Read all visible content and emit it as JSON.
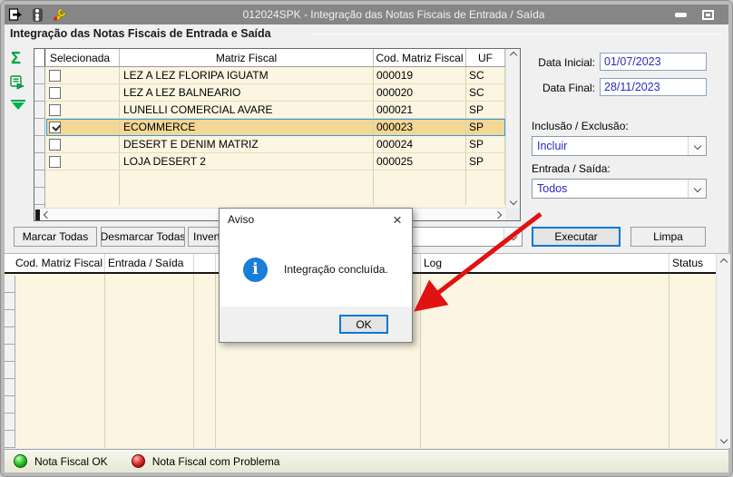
{
  "window": {
    "title": "012024SPK - Integração das Notas Fiscais de Entrada / Saída"
  },
  "groupbox": {
    "title": "Integração das Notas Fiscais de Entrada e Saída"
  },
  "icons": {
    "sigma_glyph": "Σ",
    "dialog_close_glyph": "×",
    "info_glyph": "i"
  },
  "grid": {
    "columns": [
      "Selecionada",
      "Matriz Fiscal",
      "Cod. Matriz Fiscal",
      "UF"
    ],
    "rows": [
      {
        "checked": false,
        "matriz": "LEZ A LEZ FLORIPA IGUATM",
        "cod": "000019",
        "uf": "SC"
      },
      {
        "checked": false,
        "matriz": "LEZ A LEZ BALNEARIO",
        "cod": "000020",
        "uf": "SC"
      },
      {
        "checked": false,
        "matriz": "LUNELLI COMERCIAL AVARE",
        "cod": "000021",
        "uf": "SP"
      },
      {
        "checked": true,
        "matriz": "ECOMMERCE",
        "cod": "000023",
        "uf": "SP"
      },
      {
        "checked": false,
        "matriz": "DESERT E DENIM MATRIZ",
        "cod": "000024",
        "uf": "SP"
      },
      {
        "checked": false,
        "matriz": "LOJA DESERT 2",
        "cod": "000025",
        "uf": "SP"
      }
    ]
  },
  "filters": {
    "data_inicial_label": "Data Inicial:",
    "data_inicial": "01/07/2023",
    "data_final_label": "Data Final:",
    "data_final": "28/11/2023",
    "inclusao_label": "Inclusão / Exclusão:",
    "inclusao_value": "Incluir",
    "entrada_label": "Entrada / Saída:",
    "entrada_value": "Todos"
  },
  "actions": {
    "marcar": "Marcar Todas",
    "desmarcar": "Desmarcar Todas",
    "inverte": "Inverte",
    "executar": "Executar",
    "limpa": "Limpa"
  },
  "result_grid": {
    "columns": [
      "Cod. Matriz Fiscal",
      "Entrada / Saída",
      "Log",
      "Status"
    ]
  },
  "dialog": {
    "title": "Aviso",
    "message": "Integração concluída.",
    "ok": "OK"
  },
  "legend": {
    "ok": "Nota Fiscal OK",
    "problem": "Nota Fiscal com Problema"
  },
  "colors": {
    "accent": "#0078d7",
    "titlebar": "#868686",
    "grid_background": "#fbf5e1",
    "selected_row": "#f3d795",
    "value_text": "#2a2ac8",
    "arrow": "#e01212",
    "status_ok": "#1fa51f",
    "status_problem": "#b80f0f",
    "info_icon": "#1a7dd7"
  }
}
